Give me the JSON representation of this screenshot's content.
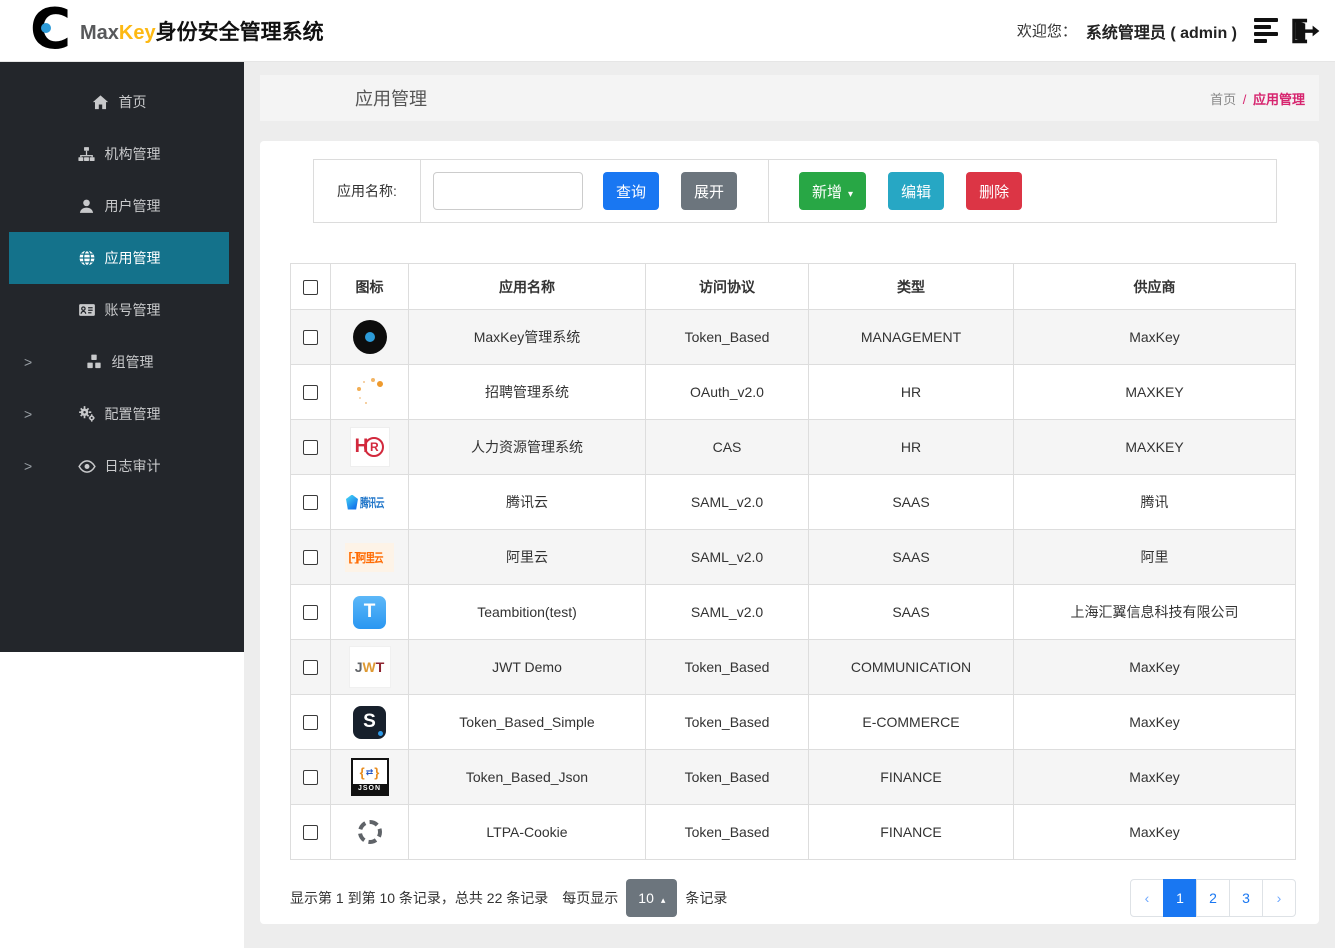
{
  "navbar": {
    "brand_max": "Max",
    "brand_key": "Key",
    "brand_suffix": "身份安全管理系统",
    "welcome_label": "欢迎您：",
    "user_label": "系统管理员 ( admin )",
    "icons": [
      "list-icon",
      "logout-icon"
    ]
  },
  "sidebar": {
    "items": [
      {
        "label": "首页",
        "icon": "home-icon",
        "active": false,
        "expandable": false
      },
      {
        "label": "机构管理",
        "icon": "org-icon",
        "active": false,
        "expandable": false
      },
      {
        "label": "用户管理",
        "icon": "user-icon",
        "active": false,
        "expandable": false
      },
      {
        "label": "应用管理",
        "icon": "globe-icon",
        "active": true,
        "expandable": false
      },
      {
        "label": "账号管理",
        "icon": "idcard-icon",
        "active": false,
        "expandable": false
      },
      {
        "label": "组管理",
        "icon": "cubes-icon",
        "active": false,
        "expandable": true
      },
      {
        "label": "配置管理",
        "icon": "gears-icon",
        "active": false,
        "expandable": true
      },
      {
        "label": "日志审计",
        "icon": "eye-icon",
        "active": false,
        "expandable": true
      }
    ]
  },
  "page": {
    "title": "应用管理",
    "breadcrumb": {
      "home": "首页",
      "sep": "/",
      "current": "应用管理"
    }
  },
  "toolbar": {
    "search_label": "应用名称:",
    "search_value": "",
    "query_label": "查询",
    "expand_label": "展开",
    "add_label": "新增",
    "add_caret": "▾",
    "edit_label": "编辑",
    "delete_label": "删除"
  },
  "table": {
    "columns": [
      "图标",
      "应用名称",
      "访问协议",
      "类型",
      "供应商"
    ],
    "rows": [
      {
        "icon": "maxkey-app-icon",
        "name": "MaxKey管理系统",
        "protocol": "Token_Based",
        "type": "MANAGEMENT",
        "vendor": "MaxKey"
      },
      {
        "icon": "spinner-dots-icon",
        "name": "招聘管理系统",
        "protocol": "OAuth_v2.0",
        "type": "HR",
        "vendor": "MAXKEY"
      },
      {
        "icon": "hr-logo-icon",
        "name": "人力资源管理系统",
        "protocol": "CAS",
        "type": "HR",
        "vendor": "MAXKEY"
      },
      {
        "icon": "tencent-cloud-icon",
        "name": "腾讯云",
        "protocol": "SAML_v2.0",
        "type": "SAAS",
        "vendor": "腾讯"
      },
      {
        "icon": "ali-cloud-icon",
        "name": "阿里云",
        "protocol": "SAML_v2.0",
        "type": "SAAS",
        "vendor": "阿里"
      },
      {
        "icon": "teambition-icon",
        "name": "Teambition(test)",
        "protocol": "SAML_v2.0",
        "type": "SAAS",
        "vendor": "上海汇翼信息科技有限公司"
      },
      {
        "icon": "jwt-icon",
        "name": "JWT Demo",
        "protocol": "Token_Based",
        "type": "COMMUNICATION",
        "vendor": "MaxKey"
      },
      {
        "icon": "s-dark-icon",
        "name": "Token_Based_Simple",
        "protocol": "Token_Based",
        "type": "E-COMMERCE",
        "vendor": "MaxKey"
      },
      {
        "icon": "json-icon",
        "name": "Token_Based_Json",
        "protocol": "Token_Based",
        "type": "FINANCE",
        "vendor": "MaxKey"
      },
      {
        "icon": "ltpa-icon",
        "name": "LTPA-Cookie",
        "protocol": "Token_Based",
        "type": "FINANCE",
        "vendor": "MaxKey"
      }
    ]
  },
  "footer": {
    "summary_text": "显示第 1 到第 10 条记录，总共 22 条记录",
    "per_page_label": "每页显示",
    "page_size": "10",
    "page_size_caret": "▴",
    "records_label": "条记录",
    "pagination": {
      "prev": "‹",
      "pages": [
        "1",
        "2",
        "3"
      ],
      "next": "›",
      "active": "1"
    }
  },
  "colors": {
    "accent_blue": "#1977f2",
    "accent_green": "#28a745",
    "accent_teal": "#27a7c4",
    "accent_red": "#dc3545",
    "sidebar_active": "#14728b",
    "breadcrumb_active": "#d6246e",
    "brand_gold": "#fdb913"
  }
}
